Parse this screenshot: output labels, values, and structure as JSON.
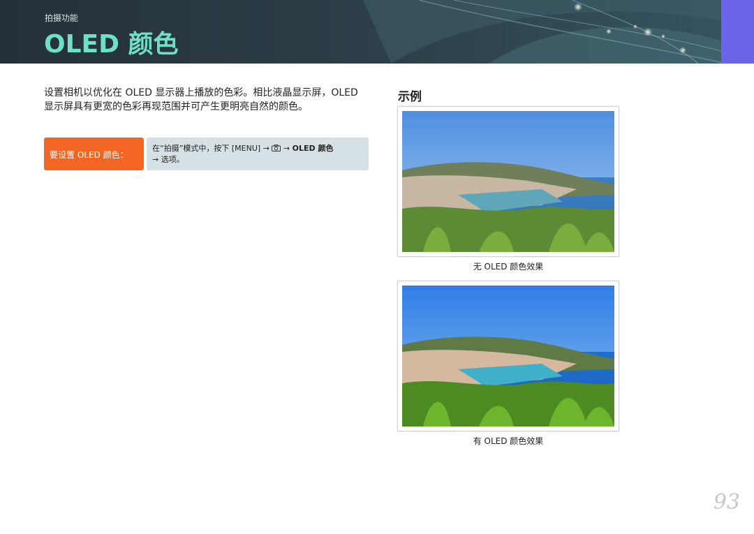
{
  "header": {
    "section": "拍摄功能",
    "title": "OLED 颜色"
  },
  "intro_text": "设置相机以优化在 OLED 显示器上播放的色彩。相比液晶显示屏，OLED 显示屏具有更宽的色彩再现范围并可产生更明亮自然的颜色。",
  "howto": {
    "label": "要设置 OLED 颜色：",
    "step_prefix": "在“拍摄”模式中，按下 [MENU] →",
    "step_arrow2": "→",
    "step_bold": "OLED 颜色",
    "step_line2": "→ 选项。",
    "icon": "camera-icon"
  },
  "example": {
    "heading": "示例",
    "images": [
      {
        "caption": "无 OLED 颜色效果"
      },
      {
        "caption": "有 OLED 颜色效果"
      }
    ]
  },
  "page_number": "93",
  "colors": {
    "title": "#6fe0c6",
    "accent_block": "#6d65e8",
    "howto_label_bg": "#f26522",
    "howto_steps_bg": "#d6e1e5"
  }
}
